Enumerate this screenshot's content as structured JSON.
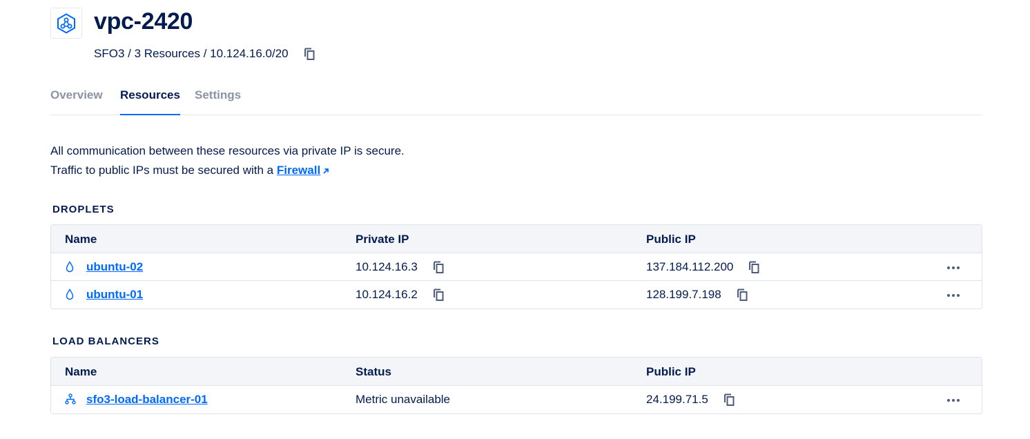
{
  "header": {
    "title": "vpc-2420",
    "subtitle": "SFO3 / 3 Resources / 10.124.16.0/20"
  },
  "tabs": [
    {
      "label": "Overview",
      "active": false
    },
    {
      "label": "Resources",
      "active": true
    },
    {
      "label": "Settings",
      "active": false
    }
  ],
  "info": {
    "line1": "All communication between these resources via private IP is secure.",
    "line2_prefix": "Traffic to public IPs must be secured with a ",
    "firewall_link": "Firewall"
  },
  "droplets": {
    "section_label": "DROPLETS",
    "columns": {
      "name": "Name",
      "private_ip": "Private IP",
      "public_ip": "Public IP"
    },
    "rows": [
      {
        "name": "ubuntu-02",
        "private_ip": "10.124.16.3",
        "public_ip": "137.184.112.200",
        "icon": "droplet-icon"
      },
      {
        "name": "ubuntu-01",
        "private_ip": "10.124.16.2",
        "public_ip": "128.199.7.198",
        "icon": "droplet-icon"
      }
    ]
  },
  "load_balancers": {
    "section_label": "LOAD BALANCERS",
    "columns": {
      "name": "Name",
      "status": "Status",
      "public_ip": "Public IP"
    },
    "rows": [
      {
        "name": "sfo3-load-balancer-01",
        "status": "Metric unavailable",
        "public_ip": "24.199.71.5",
        "icon": "load-balancer-icon"
      }
    ]
  },
  "colors": {
    "accent": "#0069ff",
    "text": "#031b4e",
    "muted_tab": "#8a94a6",
    "header_bg": "#f3f5f9"
  }
}
